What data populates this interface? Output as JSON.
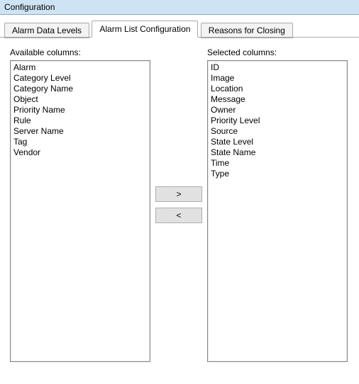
{
  "window": {
    "title": "Configuration"
  },
  "tabs": [
    {
      "label": "Alarm Data Levels",
      "active": false
    },
    {
      "label": "Alarm List Configuration",
      "active": true
    },
    {
      "label": "Reasons for Closing",
      "active": false
    }
  ],
  "panel": {
    "available_label": "Available columns:",
    "selected_label": "Selected columns:",
    "available_columns": [
      "Alarm",
      "Category Level",
      "Category Name",
      "Object",
      "Priority Name",
      "Rule",
      "Server Name",
      "Tag",
      "Vendor"
    ],
    "selected_columns": [
      "ID",
      "Image",
      "Location",
      "Message",
      "Owner",
      "Priority Level",
      "Source",
      "State Level",
      "State Name",
      "Time",
      "Type"
    ],
    "move_right_label": ">",
    "move_left_label": "<"
  }
}
